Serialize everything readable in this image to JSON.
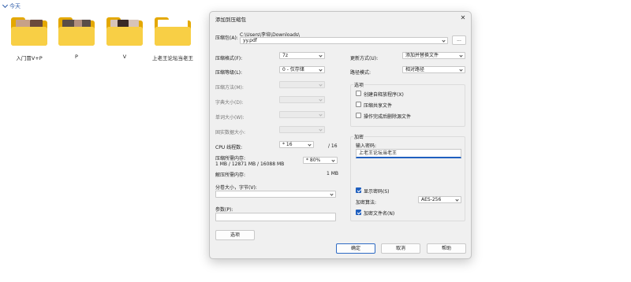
{
  "explorer": {
    "group_label": "今天",
    "folders": [
      {
        "label": "入门冒V+P"
      },
      {
        "label": "P"
      },
      {
        "label": "V"
      },
      {
        "label": "上老王论坛当老王"
      }
    ]
  },
  "dialog": {
    "title": "添加到压缩包",
    "close_icon": "close-icon",
    "archive": {
      "label": "压缩包(A):",
      "path": "C:\\Users\\李培\\Downloads\\",
      "value": "yy.pdf",
      "browse_label": "..."
    },
    "left": {
      "format_label": "压缩格式(F):",
      "format_value": "7z",
      "level_label": "压缩等级(L):",
      "level_value": "0 - 仅存储",
      "method_label": "压缩方法(M):",
      "method_value": "",
      "dict_label": "字典大小(D):",
      "dict_value": "",
      "word_label": "单词大小(W):",
      "word_value": "",
      "solid_label": "固实数据大小:",
      "solid_value": "",
      "cpu_label": "CPU 线程数:",
      "cpu_value": "16",
      "cpu_total": "/ 16",
      "mem_comp_label": "压缩所需内存:",
      "mem_comp_detail": "1 MB / 12871 MB / 16088 MB",
      "mem_percent": "80%",
      "mem_decomp_label": "解压所需内存:",
      "mem_decomp_value": "1 MB",
      "split_label": "分卷大小，字节(V):",
      "split_value": "",
      "params_label": "参数(P):",
      "params_value": "",
      "options_button": "选项"
    },
    "right": {
      "update_label": "更新方式(U):",
      "update_value": "添加并替换文件",
      "path_label": "路径模式:",
      "path_value": "相对路径",
      "options_group": "选项",
      "opt_sfx": "创建自释放程序(X)",
      "opt_sfx_checked": false,
      "opt_shared": "压缩共享文件",
      "opt_shared_checked": false,
      "opt_delete": "操作完成后删除源文件",
      "opt_delete_checked": false,
      "encryption_group": "加密",
      "password_label": "输入密码:",
      "password_value": "上老王论坛当老王",
      "show_password": "显示密码(S)",
      "show_password_checked": true,
      "enc_method_label": "加密算法:",
      "enc_method_value": "AES-256",
      "encrypt_names": "加密文件名(N)",
      "encrypt_names_checked": true
    },
    "buttons": {
      "ok": "确定",
      "cancel": "取消",
      "help": "帮助"
    }
  },
  "colors": {
    "accent": "#1f5fbf",
    "folder": "#f8cf45",
    "dialog_bg": "#f0f0f0"
  }
}
